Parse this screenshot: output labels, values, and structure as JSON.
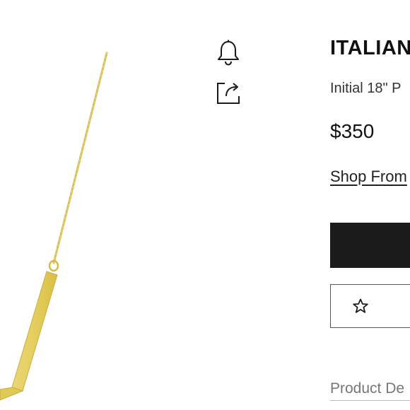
{
  "product": {
    "brand": "ITALIAN",
    "subtitle": "Initial 18\" P",
    "price": "$350",
    "shop_link": "Shop From",
    "primary_button_label": "",
    "details_tab": "Product De"
  },
  "icons": {
    "notify": "bell-icon",
    "share": "share-icon",
    "wishlist": "star-icon"
  },
  "colors": {
    "gold": "#E4CE5E",
    "button_dark": "#1B1B1B",
    "text": "#1A1A1A"
  }
}
